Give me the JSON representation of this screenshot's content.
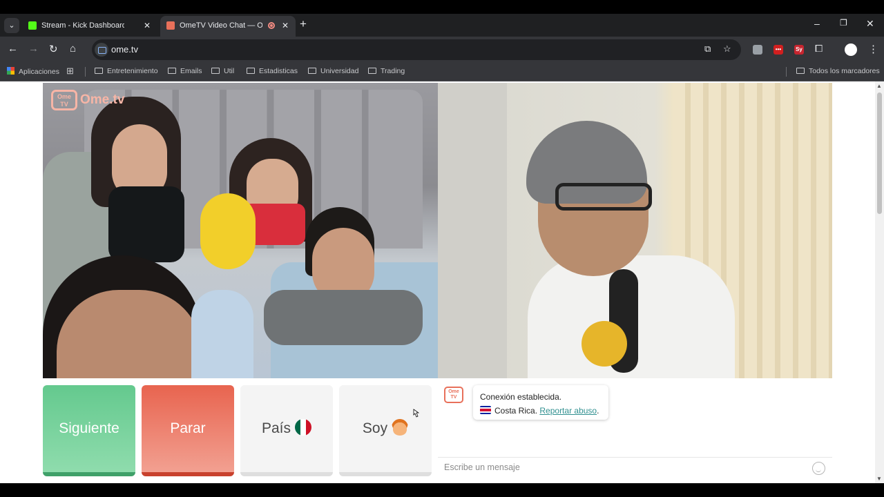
{
  "browser": {
    "tabs": [
      {
        "title": "Stream - Kick Dashboard",
        "favicon": "kick-icon",
        "color": "#53fc18"
      },
      {
        "title": "OmeTV Video Chat — Ome",
        "favicon": "ometv-icon",
        "color": "#e8705a",
        "recording": true
      }
    ],
    "url": "ome.tv",
    "bookmarks": [
      {
        "label": "Aplicaciones"
      },
      {
        "label": "Entretenimiento"
      },
      {
        "label": "Emails"
      },
      {
        "label": "Util"
      },
      {
        "label": "Estadisticas"
      },
      {
        "label": "Universidad"
      },
      {
        "label": "Trading"
      }
    ],
    "all_bookmarks": "Todos los marcadores"
  },
  "site": {
    "logo_text": "Ome.tv",
    "logo_badge": "Ome TV",
    "buttons": {
      "next": "Siguiente",
      "stop": "Parar",
      "country": "País",
      "gender": "Soy"
    },
    "chat": {
      "connection_message": "Conexión establecida.",
      "country": "Costa Rica.",
      "report_link": "Reportar abuso",
      "placeholder": "Escribe un mensaje"
    }
  }
}
